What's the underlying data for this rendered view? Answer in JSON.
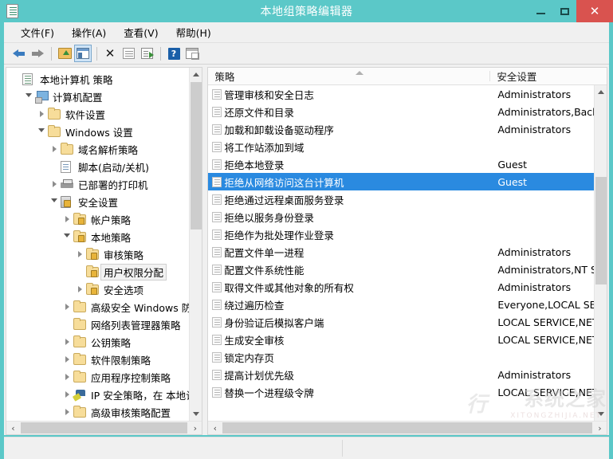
{
  "window": {
    "title": "本地组策略编辑器",
    "app_icon": "policy-document-icon",
    "accent_color": "#5bc8c8",
    "close_color": "#d9534f",
    "selection_color": "#2a8ae0",
    "minimize_label": "最小化",
    "maximize_label": "最大化",
    "close_label": "✕"
  },
  "menubar": {
    "items": [
      {
        "label": "文件(F)",
        "name": "menu-file"
      },
      {
        "label": "操作(A)",
        "name": "menu-action"
      },
      {
        "label": "查看(V)",
        "name": "menu-view"
      },
      {
        "label": "帮助(H)",
        "name": "menu-help"
      }
    ]
  },
  "toolbar": {
    "buttons": [
      {
        "icon": "back-arrow-icon",
        "label": "后退"
      },
      {
        "icon": "forward-arrow-icon",
        "label": "前进"
      },
      {
        "icon": "folder-up-icon",
        "label": "上一层"
      },
      {
        "icon": "show-hide-console-tree-icon",
        "label": "显示/隐藏控制台树",
        "active": true
      },
      {
        "icon": "delete-x-icon",
        "label": "删除"
      },
      {
        "icon": "properties-icon",
        "label": "属性"
      },
      {
        "icon": "export-list-icon",
        "label": "导出列表"
      },
      {
        "icon": "help-question-icon",
        "label": "帮助"
      },
      {
        "icon": "show-action-pane-icon",
        "label": "显示操作窗格"
      }
    ]
  },
  "tree": {
    "root_label": "本地计算机 策略",
    "nodes": [
      {
        "label": "本地计算机 策略",
        "indent": 0,
        "icon": "doc-icon",
        "twist": "none",
        "selected": false
      },
      {
        "label": "计算机配置",
        "indent": 1,
        "icon": "computer-icon",
        "twist": "open",
        "selected": false
      },
      {
        "label": "软件设置",
        "indent": 2,
        "icon": "folder-icon",
        "twist": "closed",
        "selected": false
      },
      {
        "label": "Windows 设置",
        "indent": 2,
        "icon": "folder-icon",
        "twist": "open",
        "selected": false
      },
      {
        "label": "域名解析策略",
        "indent": 3,
        "icon": "folder-icon",
        "twist": "closed",
        "selected": false
      },
      {
        "label": "脚本(启动/关机)",
        "indent": 3,
        "icon": "script-icon",
        "twist": "none",
        "selected": false
      },
      {
        "label": "已部署的打印机",
        "indent": 3,
        "icon": "printer-icon",
        "twist": "closed",
        "selected": false
      },
      {
        "label": "安全设置",
        "indent": 3,
        "icon": "server-lock-icon",
        "twist": "open",
        "selected": false
      },
      {
        "label": "帐户策略",
        "indent": 4,
        "icon": "folder-lock-icon",
        "twist": "closed",
        "selected": false
      },
      {
        "label": "本地策略",
        "indent": 4,
        "icon": "folder-lock-icon",
        "twist": "open",
        "selected": false
      },
      {
        "label": "审核策略",
        "indent": 5,
        "icon": "folder-lock-icon",
        "twist": "closed",
        "selected": false
      },
      {
        "label": "用户权限分配",
        "indent": 5,
        "icon": "folder-lock-icon",
        "twist": "none",
        "selected": true
      },
      {
        "label": "安全选项",
        "indent": 5,
        "icon": "folder-lock-icon",
        "twist": "closed",
        "selected": false
      },
      {
        "label": "高级安全 Windows 防>",
        "indent": 4,
        "icon": "folder-icon",
        "twist": "closed",
        "selected": false
      },
      {
        "label": "网络列表管理器策略",
        "indent": 4,
        "icon": "folder-icon",
        "twist": "none",
        "selected": false
      },
      {
        "label": "公钥策略",
        "indent": 4,
        "icon": "folder-icon",
        "twist": "closed",
        "selected": false
      },
      {
        "label": "软件限制策略",
        "indent": 4,
        "icon": "folder-icon",
        "twist": "closed",
        "selected": false
      },
      {
        "label": "应用程序控制策略",
        "indent": 4,
        "icon": "folder-icon",
        "twist": "closed",
        "selected": false
      },
      {
        "label": "IP 安全策略，在 本地计",
        "indent": 4,
        "icon": "ipsec-icon",
        "twist": "closed",
        "selected": false
      },
      {
        "label": "高级审核策略配置",
        "indent": 4,
        "icon": "folder-icon",
        "twist": "closed",
        "selected": false
      }
    ],
    "scroll_up_label": "向上",
    "scroll_down_label": "向下",
    "scroll_left_label": "‹",
    "scroll_right_label": "›"
  },
  "list": {
    "columns": [
      {
        "label": "策略",
        "name": "column-policy"
      },
      {
        "label": "安全设置",
        "name": "column-security-setting"
      }
    ],
    "rows": [
      {
        "policy": "管理审核和安全日志",
        "setting": "Administrators",
        "selected": false
      },
      {
        "policy": "还原文件和目录",
        "setting": "Administrators,Backu..",
        "selected": false
      },
      {
        "policy": "加载和卸载设备驱动程序",
        "setting": "Administrators",
        "selected": false
      },
      {
        "policy": "将工作站添加到域",
        "setting": "",
        "selected": false
      },
      {
        "policy": "拒绝本地登录",
        "setting": "Guest",
        "selected": false
      },
      {
        "policy": "拒绝从网络访问这台计算机",
        "setting": "Guest",
        "selected": true
      },
      {
        "policy": "拒绝通过远程桌面服务登录",
        "setting": "",
        "selected": false
      },
      {
        "policy": "拒绝以服务身份登录",
        "setting": "",
        "selected": false
      },
      {
        "policy": "拒绝作为批处理作业登录",
        "setting": "",
        "selected": false
      },
      {
        "policy": "配置文件单一进程",
        "setting": "Administrators",
        "selected": false
      },
      {
        "policy": "配置文件系统性能",
        "setting": "Administrators,NT SE..",
        "selected": false
      },
      {
        "policy": "取得文件或其他对象的所有权",
        "setting": "Administrators",
        "selected": false
      },
      {
        "policy": "绕过遍历检查",
        "setting": "Everyone,LOCAL SERV..",
        "selected": false
      },
      {
        "policy": "身份验证后模拟客户端",
        "setting": "LOCAL SERVICE,NET..",
        "selected": false
      },
      {
        "policy": "生成安全审核",
        "setting": "LOCAL SERVICE,NET..",
        "selected": false
      },
      {
        "policy": "锁定内存页",
        "setting": "",
        "selected": false
      },
      {
        "policy": "提高计划优先级",
        "setting": "Administrators",
        "selected": false
      },
      {
        "policy": "替换一个进程级令牌",
        "setting": "LOCAL SERVICE,NET..",
        "selected": false
      }
    ],
    "scroll_left_label": "‹",
    "scroll_right_label": "›"
  },
  "watermark": {
    "main": "系统之家",
    "sub": "XITONGZHIJIA.NET",
    "logo": "行"
  }
}
